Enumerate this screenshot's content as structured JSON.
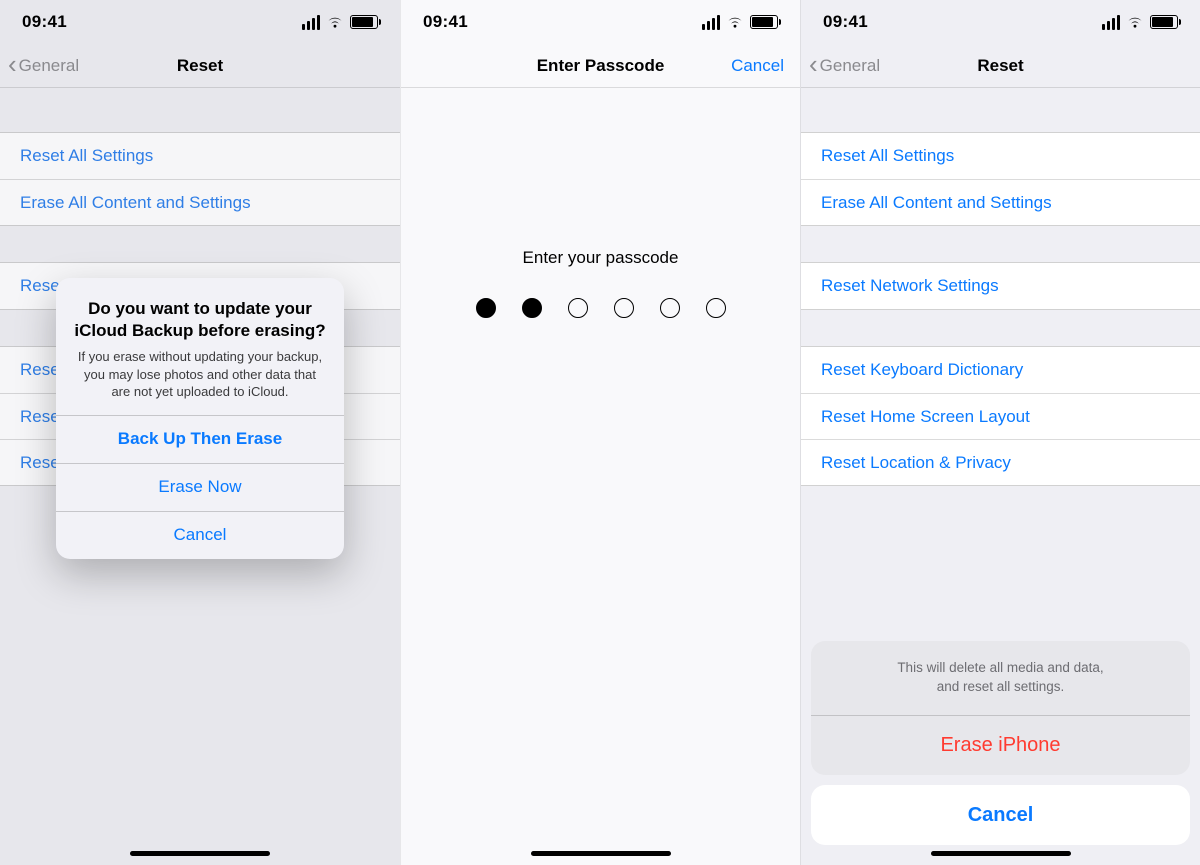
{
  "status": {
    "time": "09:41"
  },
  "reset": {
    "back_label": "General",
    "title": "Reset",
    "items": [
      "Reset All Settings",
      "Erase All Content and Settings",
      "Reset Network Settings",
      "Reset Keyboard Dictionary",
      "Reset Home Screen Layout",
      "Reset Location & Privacy"
    ],
    "partial_item_2": "Rese",
    "partial_item_3": "Rese",
    "partial_item_4": "Rese",
    "partial_item_5": "Rese"
  },
  "alert": {
    "title": "Do you want to update your iCloud Backup before erasing?",
    "message": "If you erase without updating your backup, you may lose photos and other data that are not yet uploaded to iCloud.",
    "primary": "Back Up Then Erase",
    "secondary": "Erase Now",
    "cancel": "Cancel"
  },
  "passcode": {
    "nav_title": "Enter Passcode",
    "cancel": "Cancel",
    "prompt": "Enter your passcode",
    "filled_count": 2,
    "total": 6
  },
  "sheet": {
    "message": "This will delete all media and data,\nand reset all settings.",
    "action": "Erase iPhone",
    "cancel": "Cancel"
  }
}
